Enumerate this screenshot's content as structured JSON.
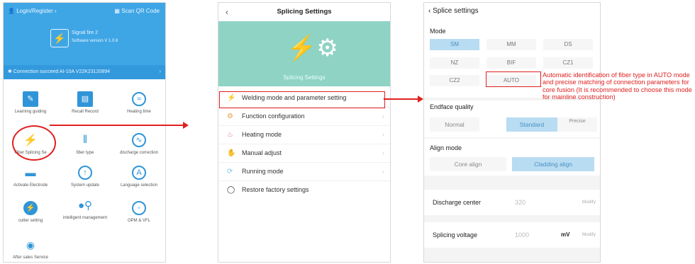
{
  "colors": {
    "accent_blue": "#3fa6e6",
    "teal": "#8fd3c4",
    "highlight_red": "#e02020",
    "selected_blue": "#b8dcf2"
  },
  "panel1": {
    "login": "Login/Register",
    "scan": "Scan QR Code",
    "device_name": "Signal fire 2",
    "device_version": "Software version V 1.0.6",
    "connection": "Connection succeed AI-10A V22K23120894",
    "grid": [
      {
        "label": "Learning guiding",
        "icon": "book-pen-icon"
      },
      {
        "label": "Recall Record",
        "icon": "records-icon"
      },
      {
        "label": "Heating time",
        "icon": "heating-time-icon"
      },
      {
        "label": "Fiber Splicing Se",
        "icon": "fiber-splicing-icon"
      },
      {
        "label": "fiber type",
        "icon": "fiber-type-icon"
      },
      {
        "label": "discharge correction",
        "icon": "discharge-icon"
      },
      {
        "label": "Activate Electrode",
        "icon": "electrode-icon"
      },
      {
        "label": "System update",
        "icon": "update-icon"
      },
      {
        "label": "Language selection",
        "icon": "language-icon"
      },
      {
        "label": "cutter setting",
        "icon": "cutter-icon"
      },
      {
        "label": "intelligent management",
        "icon": "key-user-icon"
      },
      {
        "label": "OPM & VFL",
        "icon": "gauge-icon"
      },
      {
        "label": "After sales Service",
        "icon": "support-icon"
      }
    ]
  },
  "panel2": {
    "title": "Splicing Settings",
    "hero_sub": "Splicing Settings",
    "menu": [
      {
        "label": "Welding mode and parameter setting",
        "icon": "weld-icon"
      },
      {
        "label": "Function configuration",
        "icon": "gear-icon"
      },
      {
        "label": "Heating mode",
        "icon": "heating-icon"
      },
      {
        "label": "Manual adjust",
        "icon": "manual-icon"
      },
      {
        "label": "Running mode",
        "icon": "running-icon"
      },
      {
        "label": "Restore factory settings",
        "icon": "restore-icon"
      }
    ]
  },
  "panel3": {
    "title": "Splice settings",
    "mode_label": "Mode",
    "modes": [
      "SM",
      "MM",
      "DS",
      "NZ",
      "BIF",
      "CZ1",
      "CZ2",
      "AUTO"
    ],
    "selected_mode": "SM",
    "endface_label": "Endface quality",
    "endface_options": [
      "Normal",
      "Standard",
      "Precise"
    ],
    "endface_selected": "Standard",
    "align_label": "Align mode",
    "align_options": [
      "Core align",
      "Cladding align"
    ],
    "align_selected": "Cladding align",
    "discharge_center": {
      "label": "Discharge center",
      "value": "320",
      "action": "Modify"
    },
    "splicing_voltage": {
      "label": "Splicing voltage",
      "value": "1000",
      "unit": "mV",
      "action": "Modify"
    }
  },
  "annotation": "Automatic identification of fiber type in AUTO mode and precise matching of connection parameters for core fusion (It is recommended to choose this mode for mainline construction)"
}
